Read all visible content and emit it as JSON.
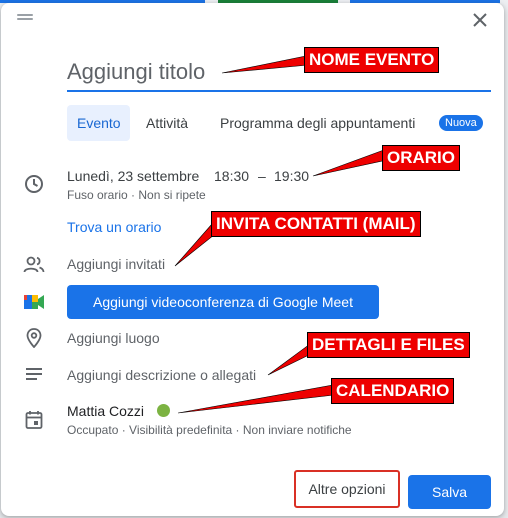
{
  "dialog": {
    "title_placeholder": "Aggiungi titolo",
    "tabs": [
      {
        "label": "Evento"
      },
      {
        "label": "Attività"
      },
      {
        "label": "Programma degli appuntamenti"
      }
    ],
    "new_badge": "Nuova",
    "date": "Lunedì, 23 settembre",
    "time_start": "18:30",
    "time_sep": "–",
    "time_end": "19:30",
    "time_details": "Fuso orario · Non si ripete",
    "find_time": "Trova un orario",
    "add_guests": "Aggiungi invitati",
    "meet_button": "Aggiungi videoconferenza di Google Meet",
    "add_location": "Aggiungi luogo",
    "add_description": "Aggiungi descrizione o allegati",
    "calendar_owner": "Mattia Cozzi",
    "calendar_details": "Occupato · Visibilità predefinita · Non inviare notifiche",
    "more_options": "Altre opzioni",
    "save": "Salva"
  },
  "annotations": [
    {
      "label": "NOME EVENTO"
    },
    {
      "label": "ORARIO"
    },
    {
      "label": "INVITA CONTATTI (MAIL)"
    },
    {
      "label": "DETTAGLI E FILES"
    },
    {
      "label": "CALENDARIO"
    }
  ],
  "colors": {
    "accent": "#1a73e8",
    "annotation_red": "#ee0000",
    "calendar_dot": "#7cb342",
    "tab_active_bg": "#e8f0fe"
  },
  "icons": [
    "drag-handle-icon",
    "close-icon",
    "clock-icon",
    "people-icon",
    "google-meet-icon",
    "location-pin-icon",
    "description-icon",
    "calendar-icon"
  ]
}
